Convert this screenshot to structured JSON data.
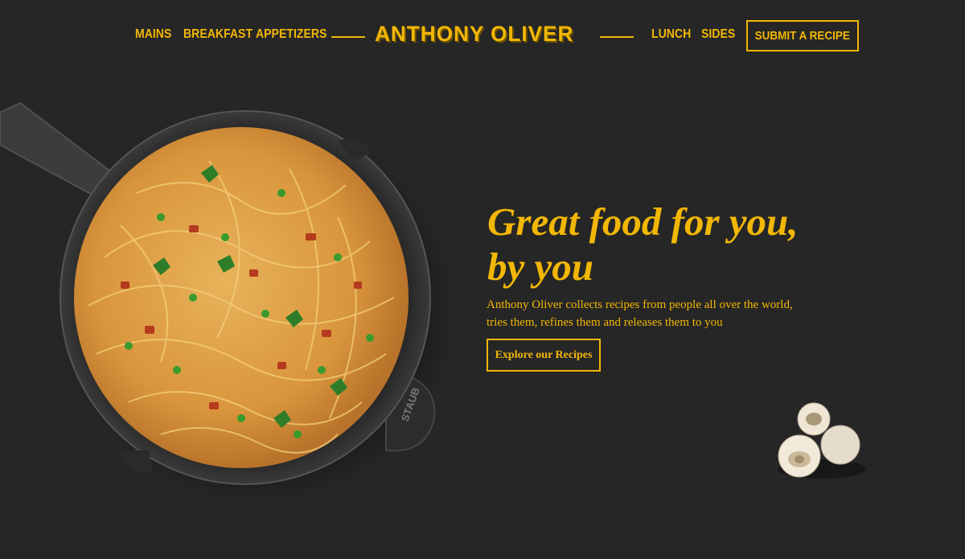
{
  "nav": {
    "left_links": [
      "MAINS",
      "BREAKFAST",
      "APPETIZERS"
    ],
    "brand": "ANTHONY OLIVER",
    "right_links": [
      "LUNCH",
      "SIDES"
    ],
    "submit_label": "SUBMIT A RECIPE"
  },
  "hero": {
    "title_line1": "Great food for you,",
    "title_line2": "by you",
    "description_line1": "Anthony Oliver collects recipes from people all over the world,",
    "description_line2": "tries them, refines them and releases them to you",
    "cta_label": "Explore our Recipes"
  },
  "images": {
    "pan_brand": "STAUB",
    "pan_image": "spaghetti-skillet-image",
    "mushroom_image": "mushrooms-image"
  },
  "colors": {
    "background": "#262626",
    "accent": "#f2b705"
  }
}
